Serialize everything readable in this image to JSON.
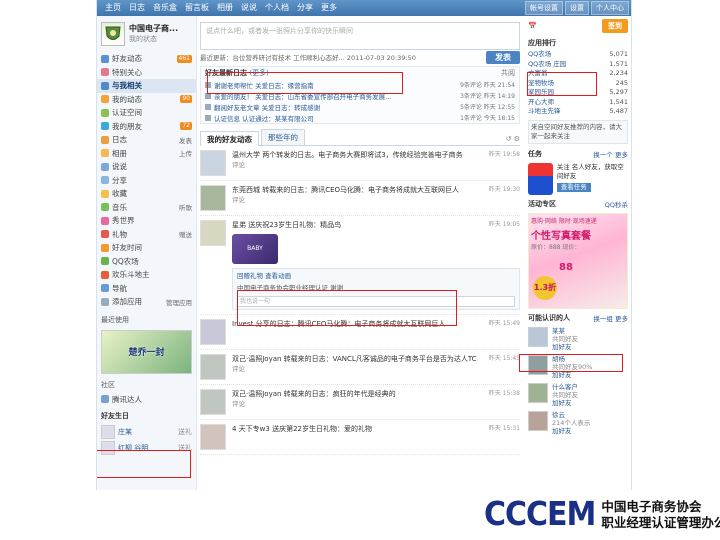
{
  "topnav": {
    "items": [
      "主页",
      "日志",
      "音乐盒",
      "留言板",
      "相册",
      "说说",
      "个人档",
      "分享",
      "更多"
    ],
    "right": [
      "帐号设置",
      "设置",
      "个人中心"
    ]
  },
  "profile": {
    "name": "中国电子商...",
    "status": "我的状态"
  },
  "sidebar": {
    "items": [
      {
        "label": "好友动态",
        "badge": "461",
        "color": "#5a8fd1"
      },
      {
        "label": "特别关心",
        "badge": "",
        "color": "#e07a8c"
      },
      {
        "label": "与我相关",
        "badge": "",
        "color": "#4d8ac9",
        "active": true
      },
      {
        "label": "我的动态",
        "badge": "90",
        "color": "#f2a33a"
      },
      {
        "label": "认证空间",
        "badge": "",
        "color": "#8cc152"
      },
      {
        "label": "我的朋友",
        "badge": "72",
        "color": "#3fa9d6"
      },
      {
        "label": "日志",
        "extra": "发表",
        "color": "#e9a23b"
      },
      {
        "label": "相册",
        "extra": "上传",
        "color": "#f5b94b"
      },
      {
        "label": "说说",
        "extra": "",
        "color": "#7aa9d6"
      },
      {
        "label": "分享",
        "extra": "",
        "color": "#8ab5e0"
      },
      {
        "label": "收藏",
        "extra": "",
        "color": "#f7c04a"
      },
      {
        "label": "音乐",
        "extra": "听歌",
        "color": "#7bbf59"
      },
      {
        "label": "秀世界",
        "extra": "",
        "color": "#e86b9e"
      },
      {
        "label": "礼物",
        "extra": "赠送",
        "color": "#e9574a"
      },
      {
        "label": "好友时间",
        "extra": "",
        "color": "#f29b2e"
      },
      {
        "label": "QQ农场",
        "extra": "",
        "color": "#69b24c"
      },
      {
        "label": "欢乐斗地主",
        "extra": "",
        "color": "#e85c3a"
      },
      {
        "label": "导航",
        "extra": "",
        "color": "#6a9ad4"
      },
      {
        "label": "添加应用",
        "extra": "管理应用",
        "color": "#9ab"
      }
    ],
    "recent_app": "最近使用",
    "game_banner": "楚乔一封",
    "community_title": "社区",
    "community_item": "腾讯达人",
    "friends_title": "好友生日",
    "friends": [
      {
        "name": "庄某",
        "action": "送礼"
      },
      {
        "name": "红柳 谷明",
        "action": "送礼"
      }
    ]
  },
  "center": {
    "post_placeholder": "说点什么吧，或者发一张照片分享你的快乐瞬间",
    "status_text": "最近更新：台位营养研讨有技术 工作顺利心态好... 2011-07-03 20:39:50",
    "post_button": "发表",
    "recent": {
      "title": "好友最新日志",
      "more": "(更多)",
      "col_right": "共阅",
      "rows": [
        {
          "text": "谢谢老师帮忙 关爱日志：缘营指南",
          "meta": "9条评论 昨天 21:54"
        },
        {
          "text": "亲爱的朋友！ 关爱日志：山东省委宣传部召开电子商务发展...",
          "meta": "3条评论 昨天 14:19"
        },
        {
          "text": "翻阅好友老文章 关爱日志：转成感谢",
          "meta": "5条评论 昨天 12:55"
        },
        {
          "text": "认证信息 认证通过：某某有限公司",
          "meta": "1条评论 今天 18:15"
        }
      ]
    },
    "tabs": [
      "我的好友动态",
      "那些年的"
    ],
    "tools": "↺ ⚙",
    "feed": [
      {
        "avatar": "#c9d4e0",
        "line": "温州大学 两个转发的日志。电子商务大赛即将试3，传统经验完善电子商务",
        "time": "昨天 19:58",
        "sub": "评论"
      },
      {
        "avatar": "#a7b79c",
        "line": "东莞西城 转载来的日志：腾讯CEO马化腾：电子商务将成就大互联网巨人",
        "time": "昨天 19:30",
        "sub": "评论"
      },
      {
        "avatar": "#d8d8c0",
        "line": "星弟 送庆祝23岁生日礼物：精品鸟",
        "time": "昨天 19:05",
        "sub": ""
      },
      {
        "avatar": "#c8c8d8",
        "line": "Invest 分享的日志：腾讯CEO马化腾：电子商务将成就大互联网巨人",
        "time": "昨天 15:49",
        "sub": ""
      },
      {
        "avatar": "#bfc6c0",
        "line": "双己·温照Joyan 转载来的日志：VANCL凡客诚品的电子商务平台是否为达人TC",
        "time": "昨天 15:43",
        "sub": "评论"
      },
      {
        "avatar": "#c0c7c1",
        "line": "双己·温照Joyan 转载来的日志：疯狂的年代是经典的",
        "time": "昨天 15:38",
        "sub": "评论"
      },
      {
        "avatar": "#d2c4bd",
        "line": "4 天下专w3 送庆第22岁生日礼物：爱的礼物",
        "time": "昨天 15:31",
        "sub": ""
      }
    ],
    "gift_label": "BABY",
    "comment": {
      "links": "回赠礼物  查看动画",
      "text": "中国电子商务协会职业经理认证 谢谢",
      "input_placeholder": "我也说一句"
    }
  },
  "right": {
    "sign_button": "签到",
    "apps_title": "应用排行",
    "apps_more": "",
    "apps": [
      {
        "name": "QQ农场",
        "count": "5,071"
      },
      {
        "name": "QQ农场 庄园",
        "count": "1,571"
      },
      {
        "name": "大富翁",
        "count": "2,234"
      },
      {
        "name": "宠物牧场",
        "count": "245"
      },
      {
        "name": "家园乐园",
        "count": "5,297"
      },
      {
        "name": "开心大师",
        "count": "1,541"
      },
      {
        "name": "斗地主先锋",
        "count": "5,487"
      }
    ],
    "notice": "来自空间好友推荐的内容，请大家一起来关注",
    "task_title": "任务",
    "task_more": "换一个 更多",
    "task_text": "关注 名人好友，获取空间好友",
    "task_button": "查看任务",
    "ad_title": "活动专区",
    "ad_more": "QQ秒杀",
    "ad_top": "惠购·网络 限时·现场速递",
    "ad_big": "个性写真套餐",
    "ad_price": "原价：888  现价：",
    "ad_88": "88",
    "ad_discount": "1.3折",
    "people_title": "可能认识的人",
    "people_more": "换一组 更多",
    "people": [
      {
        "name": "某某",
        "desc": "共同好友",
        "action": "加好友",
        "color": "#b9c7d6"
      },
      {
        "name": "胡杨",
        "desc": "共同好友90%",
        "action": "加好友",
        "color": "#8f9fa0"
      },
      {
        "name": "什么客户",
        "desc": "共同好友",
        "action": "加好友",
        "color": "#9fb394"
      },
      {
        "name": "徐云",
        "desc": "214个人表示",
        "action": "加好友",
        "color": "#b8a39a"
      }
    ]
  },
  "logo": {
    "mark": "CCCEM",
    "line1": "中国电子商务协会",
    "line2": "职业经理认证管理办公室"
  }
}
